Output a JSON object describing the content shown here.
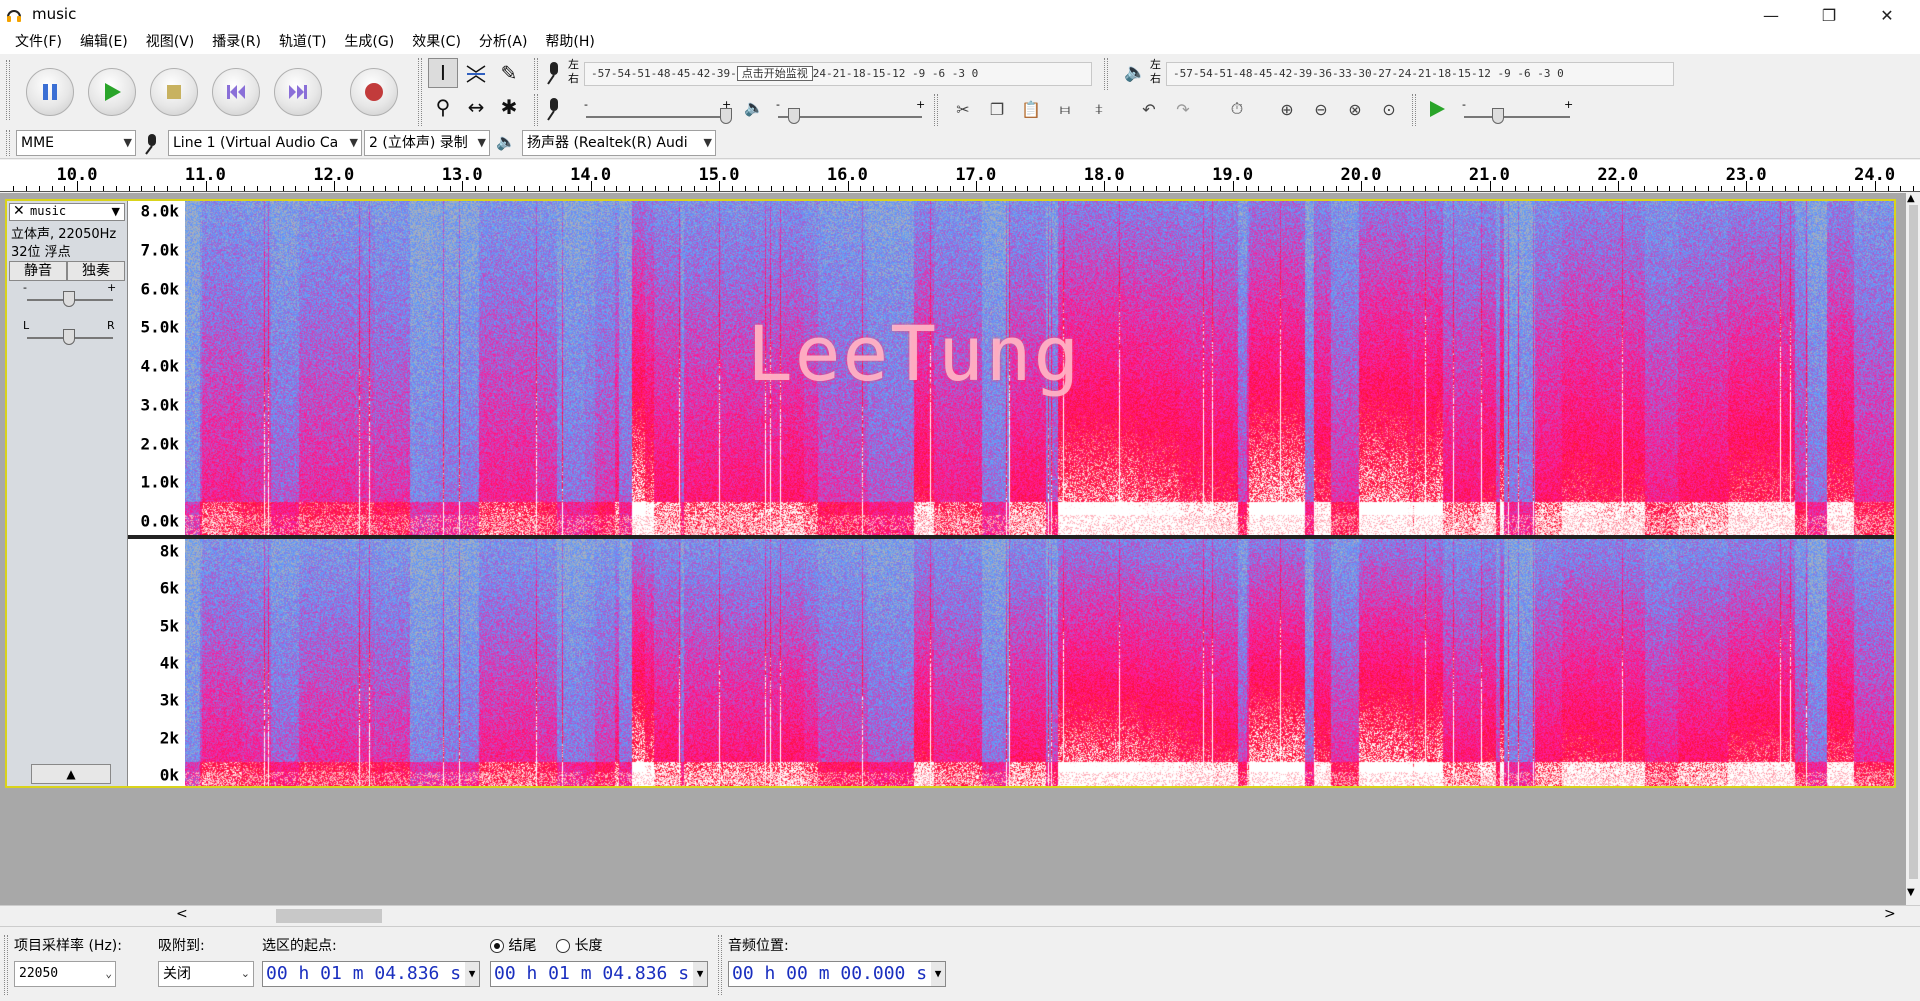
{
  "window": {
    "title": "music",
    "minimize": "—",
    "maximize": "❐",
    "close": "✕"
  },
  "menu": [
    "文件(F)",
    "编辑(E)",
    "视图(V)",
    "播录(R)",
    "轨道(T)",
    "生成(G)",
    "效果(C)",
    "分析(A)",
    "帮助(H)"
  ],
  "meters": {
    "rec_lr": "左\n右",
    "rec_scale": "-57-54-51-48-45-42-39-",
    "rec_prompt": "点击开始监视",
    "rec_scale_tail": "24-21-18-15-12 -9 -6 -3 0",
    "play_lr": "左\n右",
    "play_scale": "-57-54-51-48-45-42-39-36-33-30-27-24-21-18-15-12 -9 -6 -3 0"
  },
  "mixer": {
    "minus": "-",
    "plus": "+"
  },
  "devices": {
    "host": "MME",
    "input": "Line 1 (Virtual Audio Ca",
    "channels": "2 (立体声) 录制",
    "output": "扬声器 (Realtek(R) Audi"
  },
  "ruler": {
    "labels": [
      "10.0",
      "11.0",
      "12.0",
      "13.0",
      "14.0",
      "15.0",
      "16.0",
      "17.0",
      "18.0",
      "19.0",
      "20.0",
      "21.0",
      "22.0",
      "23.0",
      "24.0"
    ]
  },
  "track": {
    "name": "music",
    "info1": "立体声, 22050Hz",
    "info2": "32位 浮点",
    "mute": "静音",
    "solo": "独奏",
    "ch1_freq": [
      "8.0k",
      "7.0k",
      "6.0k",
      "5.0k",
      "4.0k",
      "3.0k",
      "2.0k",
      "1.0k",
      "0.0k"
    ],
    "ch2_freq": [
      "8k",
      "6k",
      "5k",
      "4k",
      "3k",
      "2k",
      "0k"
    ],
    "watermark": "LeeTung",
    "collapse": "▲"
  },
  "selection": {
    "rate_label": "项目采样率 (Hz):",
    "rate_value": "22050",
    "snap_label": "吸附到:",
    "snap_value": "关闭",
    "start_label": "选区的起点:",
    "start_value": "00 h 01 m 04.836 s",
    "end_label": "结尾",
    "length_label": "长度",
    "end_value": "00 h 01 m 04.836 s",
    "pos_label": "音频位置:",
    "pos_value": "00 h 00 m 00.000 s"
  },
  "scroll": {
    "left": "<",
    "right": ">",
    "up": "▲",
    "down": "▼"
  },
  "colors": {
    "spec_low": "#5a9cff",
    "spec_mid": "#ff1a9a",
    "spec_high": "#ff1030",
    "spec_peak": "#ffffff",
    "selection_border": "#d9d31b"
  }
}
